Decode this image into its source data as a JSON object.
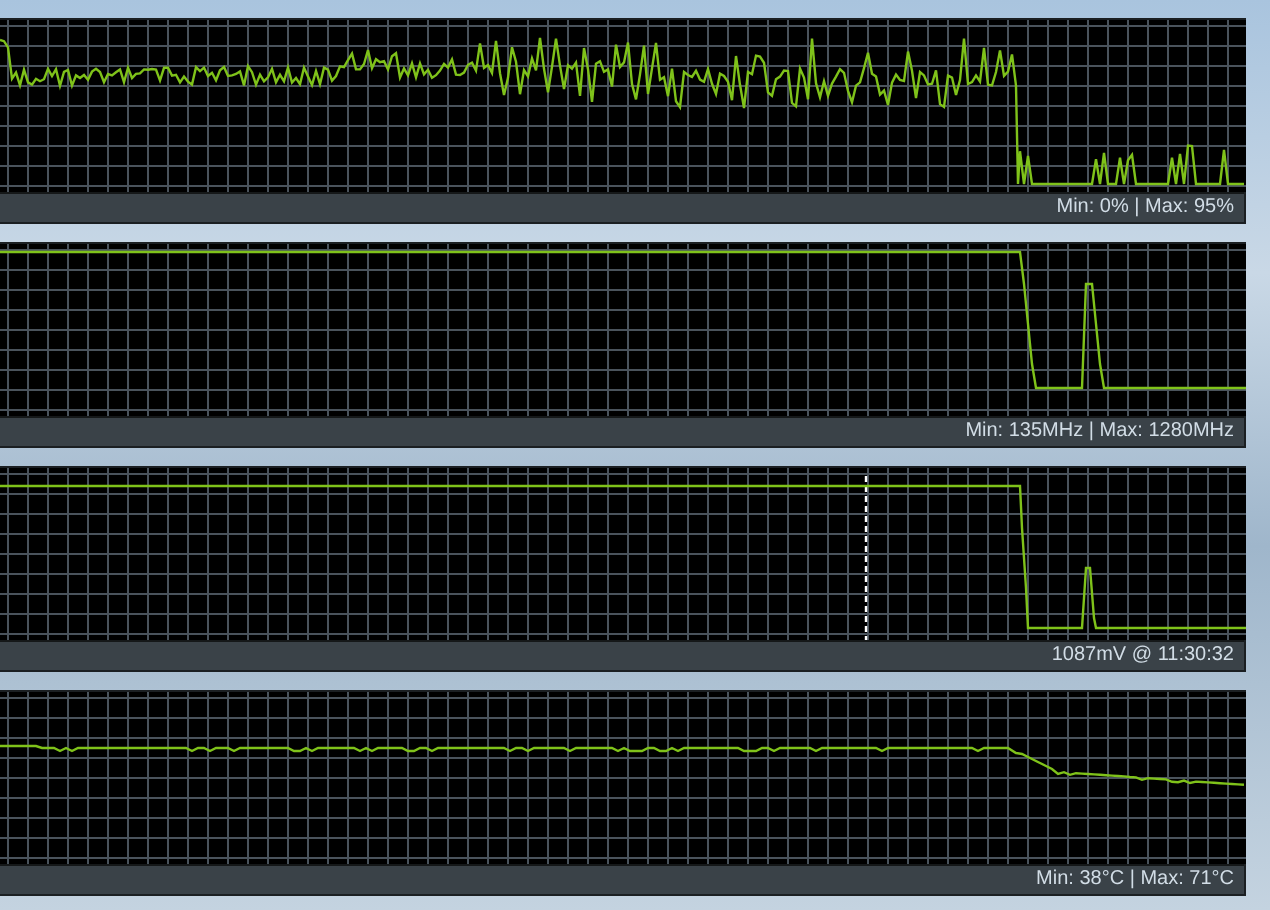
{
  "panels": [
    {
      "kind": "noisy",
      "status": "Min: 0% | Max: 95%"
    },
    {
      "kind": "step",
      "status": "Min: 135MHz | Max: 1280MHz"
    },
    {
      "kind": "step-marker",
      "status": "1087mV @ 11:30:32"
    },
    {
      "kind": "smooth",
      "status": "Min: 38°C | Max: 71°C"
    }
  ]
}
